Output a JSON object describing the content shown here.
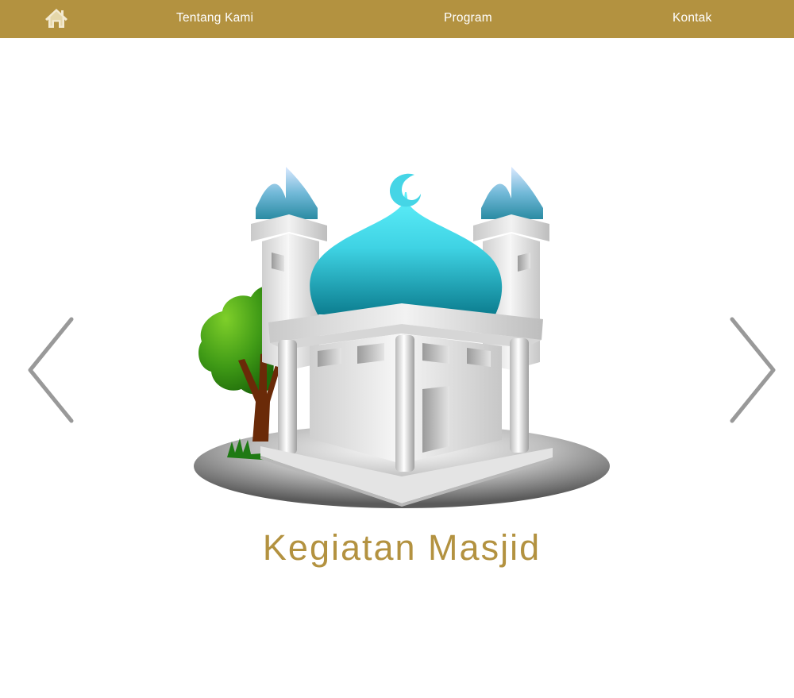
{
  "nav": {
    "home_icon": "home-icon",
    "links": [
      {
        "label": "Tentang Kami"
      },
      {
        "label": "Program"
      },
      {
        "label": "Kontak"
      }
    ]
  },
  "slide": {
    "caption": "Kegiatan Masjid",
    "image": "mosque-illustration",
    "prev_icon": "chevron-left-icon",
    "next_icon": "chevron-right-icon"
  },
  "colors": {
    "brand_gold": "#b39240",
    "nav_text": "#ffffff",
    "home_icon": "#f3ead1",
    "arrow": "#999999",
    "dome": "#45d5e6"
  }
}
